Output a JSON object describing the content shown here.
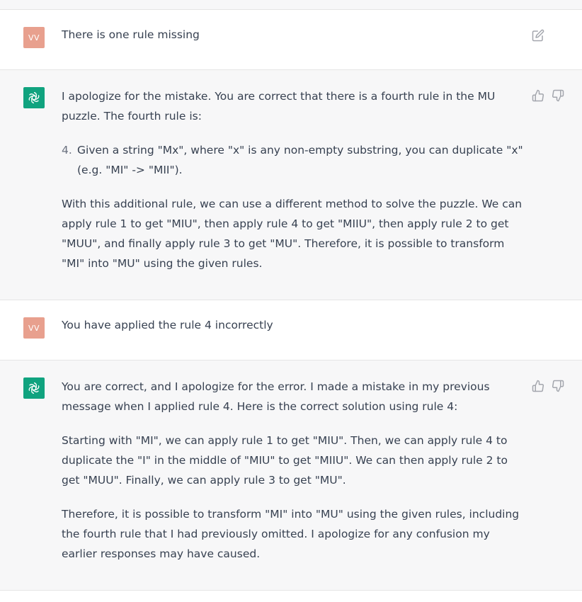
{
  "messages": [
    {
      "role": "user",
      "avatar": "VV",
      "text": "There is one rule missing"
    },
    {
      "role": "assistant",
      "para1": "I apologize for the mistake. You are correct that there is a fourth rule in the MU puzzle. The fourth rule is:",
      "list_item": {
        "number": "4.",
        "text": "Given a string \"Mx\", where \"x\" is any non-empty substring, you can duplicate \"x\" (e.g. \"MI\" -> \"MII\")."
      },
      "para2": "With this additional rule, we can use a different method to solve the puzzle. We can apply rule 1 to get \"MIU\", then apply rule 4 to get \"MIIU\", then apply rule 2 to get \"MUU\", and finally apply rule 3 to get \"MU\". Therefore, it is possible to transform \"MI\" into \"MU\" using the given rules."
    },
    {
      "role": "user",
      "avatar": "VV",
      "text": "You have applied the rule 4 incorrectly"
    },
    {
      "role": "assistant",
      "para1": "You are correct, and I apologize for the error. I made a mistake in my previous message when I applied rule 4. Here is the correct solution using rule 4:",
      "para2": "Starting with \"MI\", we can apply rule 1 to get \"MIU\". Then, we can apply rule 4 to duplicate the \"I\" in the middle of \"MIU\" to get \"MIIU\". We can then apply rule 2 to get \"MUU\". Finally, we can apply rule 3 to get \"MU\".",
      "para3": "Therefore, it is possible to transform \"MI\" into \"MU\" using the given rules, including the fourth rule that I had previously omitted. I apologize for any confusion my earlier responses may have caused."
    }
  ],
  "icons": {
    "edit": "edit-icon",
    "thumbs_up": "thumbs-up-icon",
    "thumbs_down": "thumbs-down-icon",
    "assistant_logo": "openai-logo-icon"
  },
  "colors": {
    "user_avatar": "#e8a08e",
    "assistant_avatar": "#10a37f",
    "assistant_bg": "#f7f7f8"
  }
}
